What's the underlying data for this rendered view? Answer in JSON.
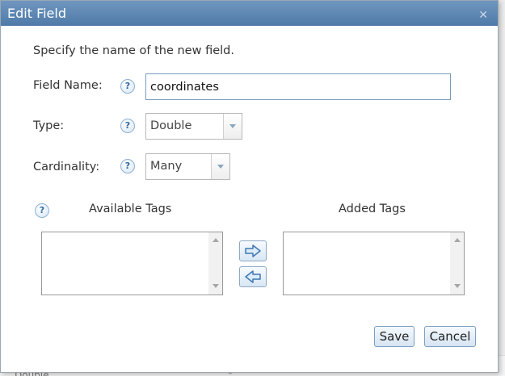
{
  "dialog": {
    "title": "Edit Field",
    "close_glyph": "✕",
    "instruction": "Specify the name of the new field.",
    "help_glyph": "?"
  },
  "field_name": {
    "label": "Field Name:",
    "value": "coordinates"
  },
  "type": {
    "label": "Type:",
    "selected": "Double"
  },
  "cardinality": {
    "label": "Cardinality:",
    "selected": "Many"
  },
  "tags": {
    "available_label": "Available Tags",
    "added_label": "Added Tags",
    "available_items": [],
    "added_items": []
  },
  "buttons": {
    "save": "Save",
    "cancel": "Cancel"
  },
  "background": {
    "row_text": "Double",
    "row_mark": "\""
  },
  "icons": {
    "help": "help-icon",
    "close": "close-icon",
    "move_right": "arrow-right-icon",
    "move_left": "arrow-left-icon"
  }
}
